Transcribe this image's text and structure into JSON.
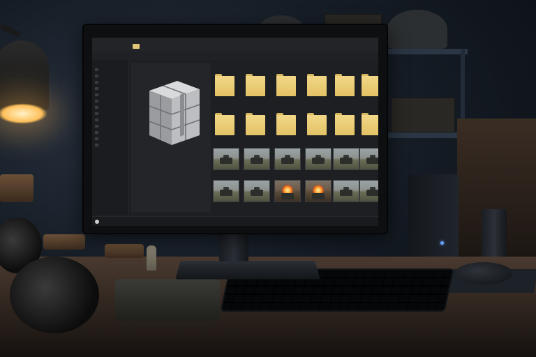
{
  "window": {
    "title": "",
    "folder_icon": "folder-icon",
    "status_text": ""
  },
  "sidebar": {
    "item_count": 13
  },
  "preview": {
    "icon": "archive-icon"
  },
  "grid": {
    "folders": [
      {
        "icon": "folder-icon"
      },
      {
        "icon": "folder-icon"
      },
      {
        "icon": "folder-icon"
      },
      {
        "icon": "folder-icon"
      },
      {
        "icon": "folder-icon"
      },
      {
        "icon": "folder-icon"
      },
      {
        "icon": "folder-icon"
      },
      {
        "icon": "folder-icon"
      },
      {
        "icon": "folder-icon"
      },
      {
        "icon": "folder-icon"
      },
      {
        "icon": "folder-icon"
      },
      {
        "icon": "folder-icon"
      }
    ],
    "thumbnails": [
      {
        "kind": "tank"
      },
      {
        "kind": "tank"
      },
      {
        "kind": "tank"
      },
      {
        "kind": "tank"
      },
      {
        "kind": "tank"
      },
      {
        "kind": "tank"
      },
      {
        "kind": "tank"
      },
      {
        "kind": "tank"
      },
      {
        "kind": "fire"
      },
      {
        "kind": "fire"
      },
      {
        "kind": "tank"
      },
      {
        "kind": "tank"
      }
    ]
  },
  "colors": {
    "folder": "#e8c874",
    "screen_bg": "#1e1f22",
    "lamp_glow": "#ffbf5a"
  }
}
